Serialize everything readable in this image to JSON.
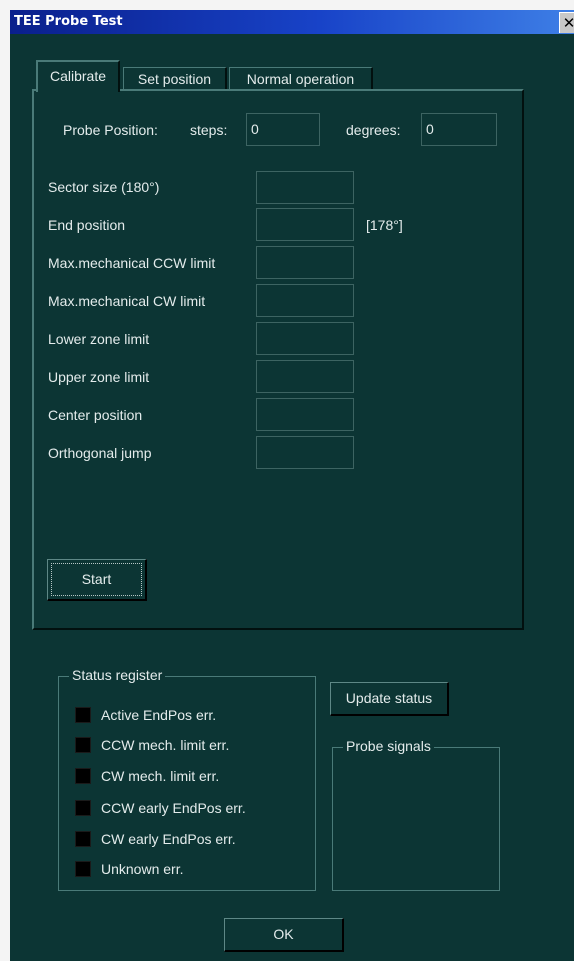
{
  "window": {
    "title": "TEE Probe Test",
    "close_glyph": "✕"
  },
  "tabs": [
    {
      "label": "Calibrate",
      "active": true
    },
    {
      "label": "Set position",
      "active": false
    },
    {
      "label": "Normal operation",
      "active": false
    }
  ],
  "probe_position": {
    "label": "Probe Position:",
    "steps_label": "steps:",
    "steps_value": "0",
    "degrees_label": "degrees:",
    "degrees_value": "0"
  },
  "calibration_fields": [
    {
      "label": "Sector size (180°)",
      "value": "",
      "note": ""
    },
    {
      "label": "End position",
      "value": "",
      "note": "[178°]"
    },
    {
      "label": "Max.mechanical CCW limit",
      "value": "",
      "note": ""
    },
    {
      "label": "Max.mechanical CW limit",
      "value": "",
      "note": ""
    },
    {
      "label": "Lower zone limit",
      "value": "",
      "note": ""
    },
    {
      "label": "Upper zone limit",
      "value": "",
      "note": ""
    },
    {
      "label": "Center position",
      "value": "",
      "note": ""
    },
    {
      "label": "Orthogonal jump",
      "value": "",
      "note": ""
    }
  ],
  "start_button": "Start",
  "status_register": {
    "title": "Status register",
    "items": [
      "Active EndPos err.",
      "CCW mech. limit err.",
      "CW mech. limit err.",
      "CCW early EndPos err.",
      "CW early EndPos err.",
      "Unknown err."
    ]
  },
  "update_status_button": "Update status",
  "probe_signals": {
    "title": "Probe signals"
  },
  "ok_button": "OK"
}
